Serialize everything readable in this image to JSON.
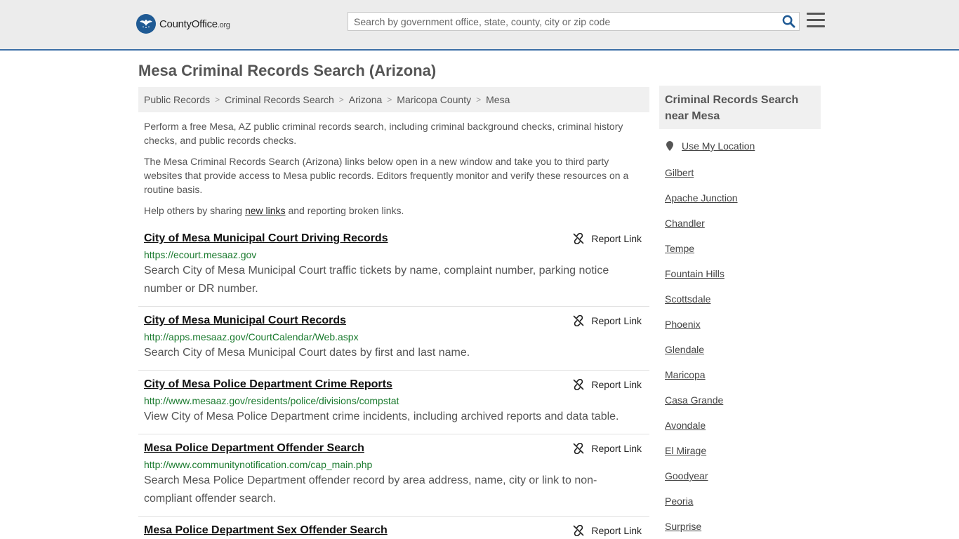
{
  "header": {
    "logo_main": "CountyOffice",
    "logo_ext": ".org",
    "search_placeholder": "Search by government office, state, county, city or zip code",
    "search_value": ""
  },
  "page_title": "Mesa Criminal Records Search (Arizona)",
  "breadcrumb": [
    "Public Records",
    "Criminal Records Search",
    "Arizona",
    "Maricopa County",
    "Mesa"
  ],
  "intro": {
    "p1": "Perform a free Mesa, AZ public criminal records search, including criminal background checks, criminal history checks, and public records checks.",
    "p2": "The Mesa Criminal Records Search (Arizona) links below open in a new window and take you to third party websites that provide access to Mesa public records. Editors frequently monitor and verify these resources on a routine basis.",
    "p3_before": "Help others by sharing ",
    "p3_link": "new links",
    "p3_after": " and reporting broken links."
  },
  "report_label": "Report Link",
  "results": [
    {
      "title": "City of Mesa Municipal Court Driving Records",
      "url": "https://ecourt.mesaaz.gov",
      "desc": "Search City of Mesa Municipal Court traffic tickets by name, complaint number, parking notice number or DR number."
    },
    {
      "title": "City of Mesa Municipal Court Records",
      "url": "http://apps.mesaaz.gov/CourtCalendar/Web.aspx",
      "desc": "Search City of Mesa Municipal Court dates by first and last name."
    },
    {
      "title": "City of Mesa Police Department Crime Reports",
      "url": "http://www.mesaaz.gov/residents/police/divisions/compstat",
      "desc": "View City of Mesa Police Department crime incidents, including archived reports and data table."
    },
    {
      "title": "Mesa Police Department Offender Search",
      "url": "http://www.communitynotification.com/cap_main.php",
      "desc": "Search Mesa Police Department offender record by area address, name, city or link to non-compliant offender search."
    },
    {
      "title": "Mesa Police Department Sex Offender Search",
      "url": "",
      "desc": ""
    }
  ],
  "sidebar": {
    "heading": "Criminal Records Search near Mesa",
    "use_location": "Use My Location",
    "links": [
      "Gilbert",
      "Apache Junction",
      "Chandler",
      "Tempe",
      "Fountain Hills",
      "Scottsdale",
      "Phoenix",
      "Glendale",
      "Maricopa",
      "Casa Grande",
      "Avondale",
      "El Mirage",
      "Goodyear",
      "Peoria",
      "Surprise"
    ]
  },
  "colors": {
    "header_bg": "#ececec",
    "header_border": "#3d6fa6",
    "logo_blue": "#1f5a94",
    "search_icon": "#1f5a94",
    "url_green": "#1a7a2e"
  }
}
